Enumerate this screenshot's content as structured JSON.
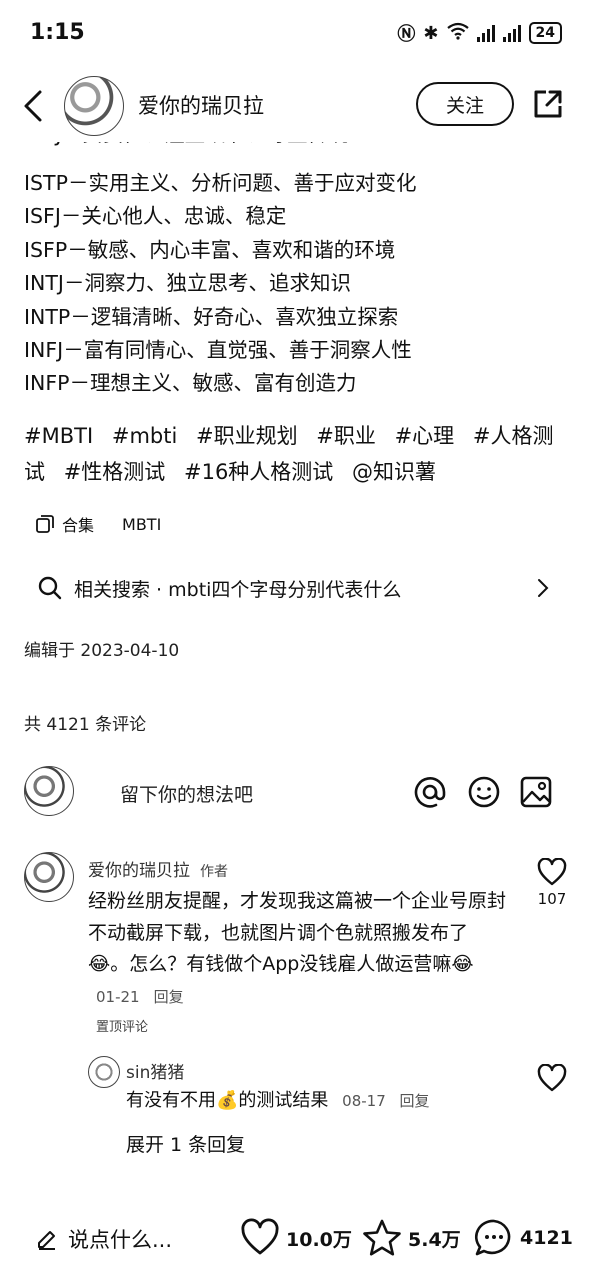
{
  "status_bar": {
    "time": "1:15",
    "battery": "24"
  },
  "nav": {
    "author_name": "爱你的瑞贝拉",
    "follow_label": "关注"
  },
  "post": {
    "cut_line": "ISTJ－负责任、注重细节、尊重传统",
    "mbti_lines": [
      "ISTP－实用主义、分析问题、善于应对变化",
      "ISFJ－关心他人、忠诚、稳定",
      "ISFP－敏感、内心丰富、喜欢和谐的环境",
      "INTJ－洞察力、独立思考、追求知识",
      "INTP－逻辑清晰、好奇心、喜欢独立探索",
      "INFJ－富有同情心、直觉强、善于洞察人性",
      "INFP－理想主义、敏感、富有创造力"
    ],
    "tags": [
      "#MBTI",
      "#mbti",
      "#职业规划",
      "#职业",
      "#心理",
      "#人格测试",
      "#性格测试",
      "#16种人格测试",
      "@知识薯"
    ],
    "collection_label": "合集",
    "collection_name": "MBTI",
    "related_search": "相关搜索 · mbti四个字母分别代表什么",
    "edit_date": "编辑于 2023-04-10"
  },
  "comments_section": {
    "count_text": "共 4121 条评论",
    "input_placeholder": "留下你的想法吧"
  },
  "comment1": {
    "name": "爱你的瑞贝拉",
    "badge": "作者",
    "text": "经粉丝朋友提醒，才发现我这篇被一个企业号原封不动截屏下载，也就图片调个色就照搬发布了😂。怎么？有钱做个App没钱雇人做运营嘛😂",
    "date": "01-21",
    "reply_label": "回复",
    "pinned": "置顶评论",
    "likes": "107"
  },
  "reply1": {
    "name": "sin猪猪",
    "text": "有没有不用💰的测试结果",
    "date": "08-17",
    "reply_label": "回复"
  },
  "expand_label": "展开 1 条回复",
  "bottom": {
    "say_label": "说点什么...",
    "likes": "10.0万",
    "stars": "5.4万",
    "comments": "4121"
  }
}
